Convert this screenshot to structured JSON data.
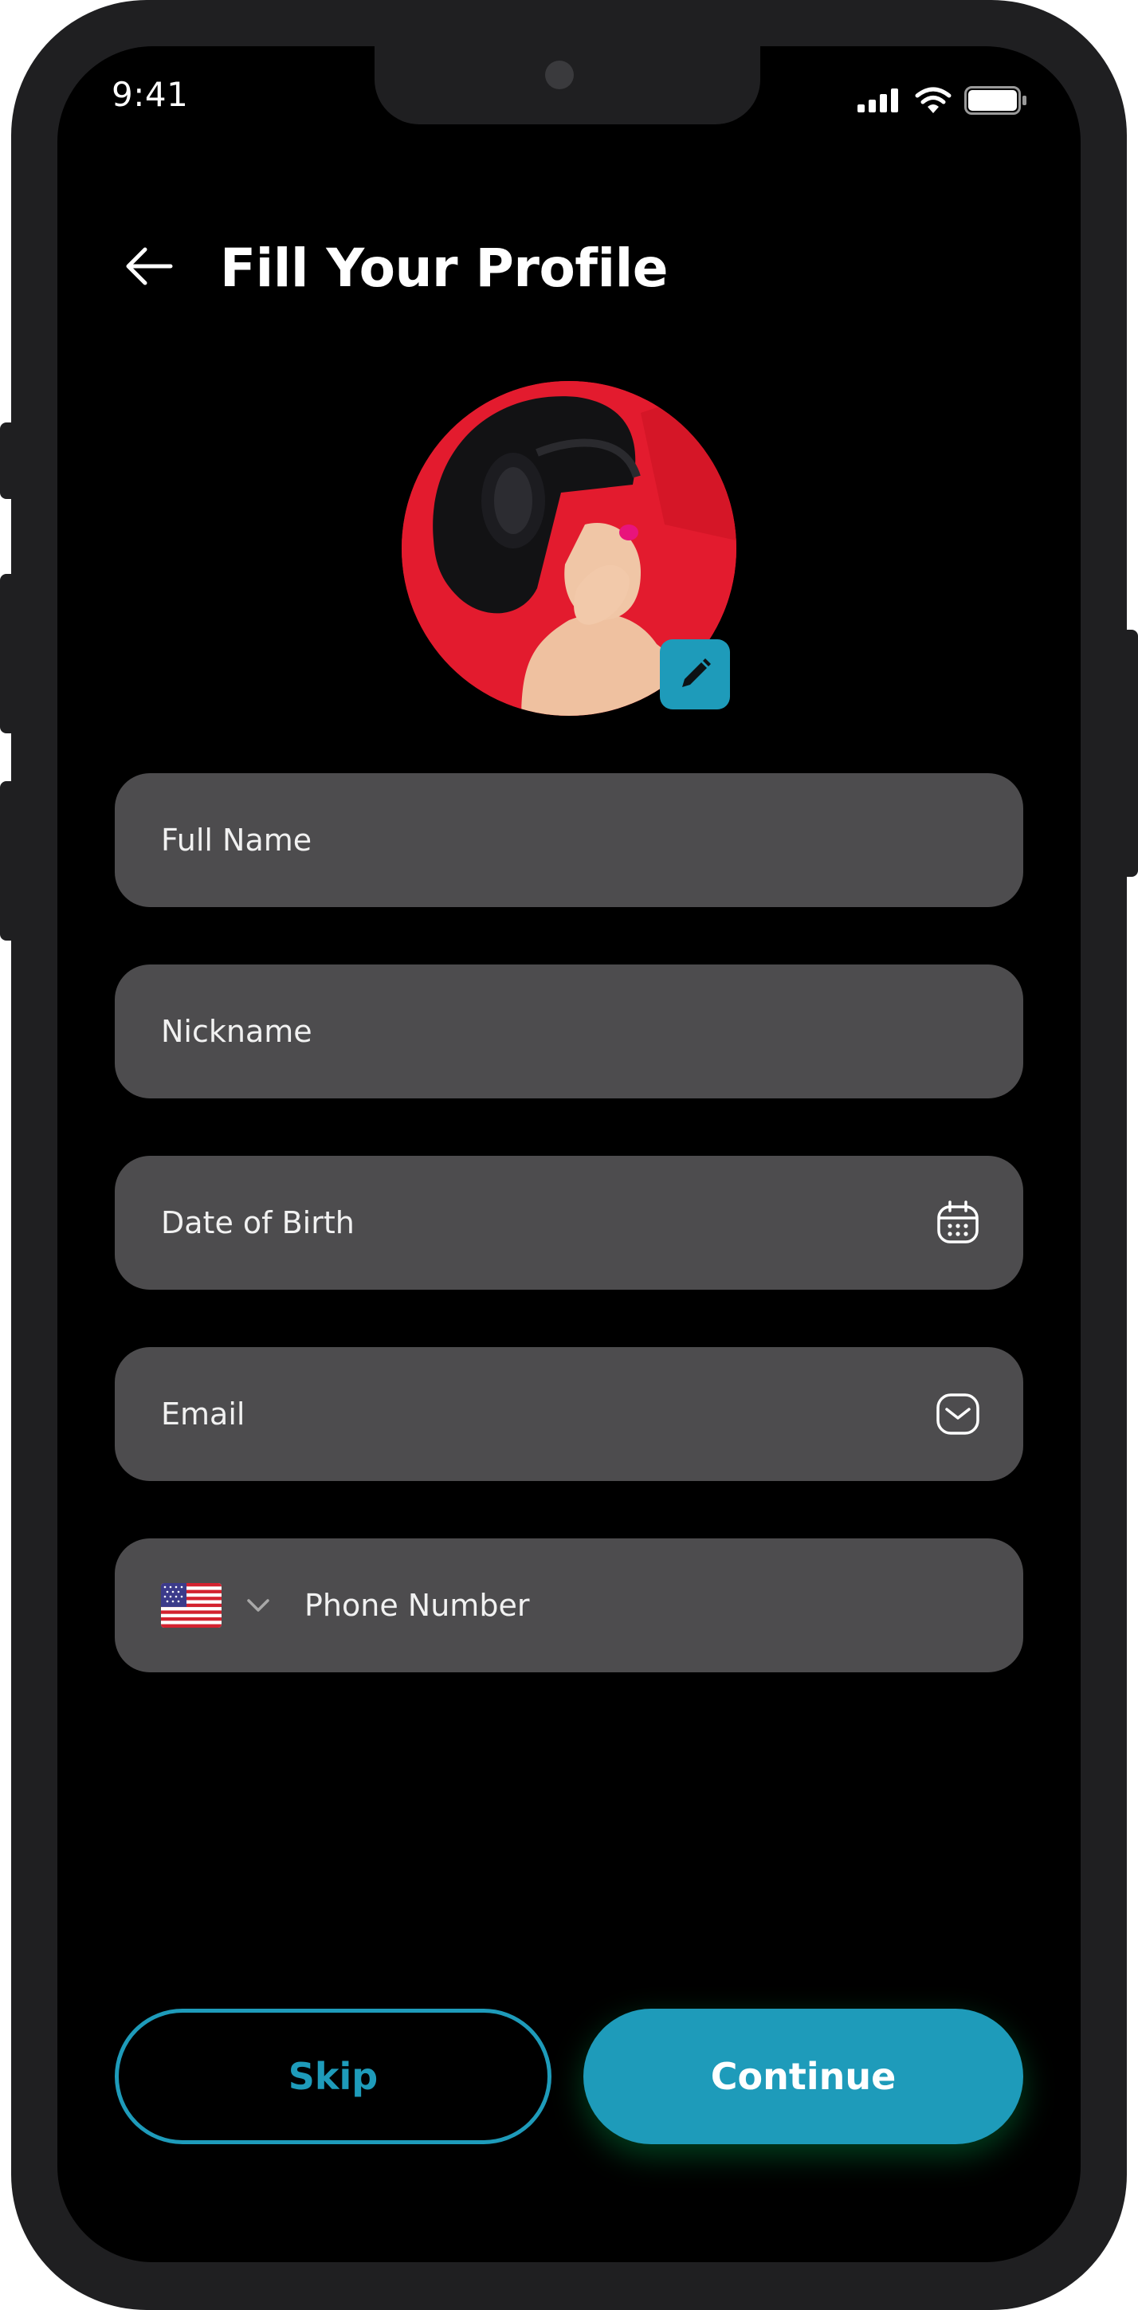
{
  "status_bar": {
    "time": "9:41"
  },
  "header": {
    "title": "Fill Your Profile"
  },
  "form": {
    "full_name_placeholder": "Full Name",
    "nickname_placeholder": "Nickname",
    "dob_placeholder": "Date of Birth",
    "email_placeholder": "Email",
    "phone_placeholder": "Phone Number"
  },
  "actions": {
    "skip_label": "Skip",
    "continue_label": "Continue"
  },
  "icons": {
    "back": "arrow-left-icon",
    "edit": "pencil-icon",
    "calendar": "calendar-icon",
    "email": "mail-icon",
    "flag": "us-flag-icon",
    "dropdown": "chevron-down-icon"
  },
  "colors": {
    "accent": "#1E9BBA",
    "field_bg": "#4D4C4E",
    "screen_bg": "#000000"
  }
}
